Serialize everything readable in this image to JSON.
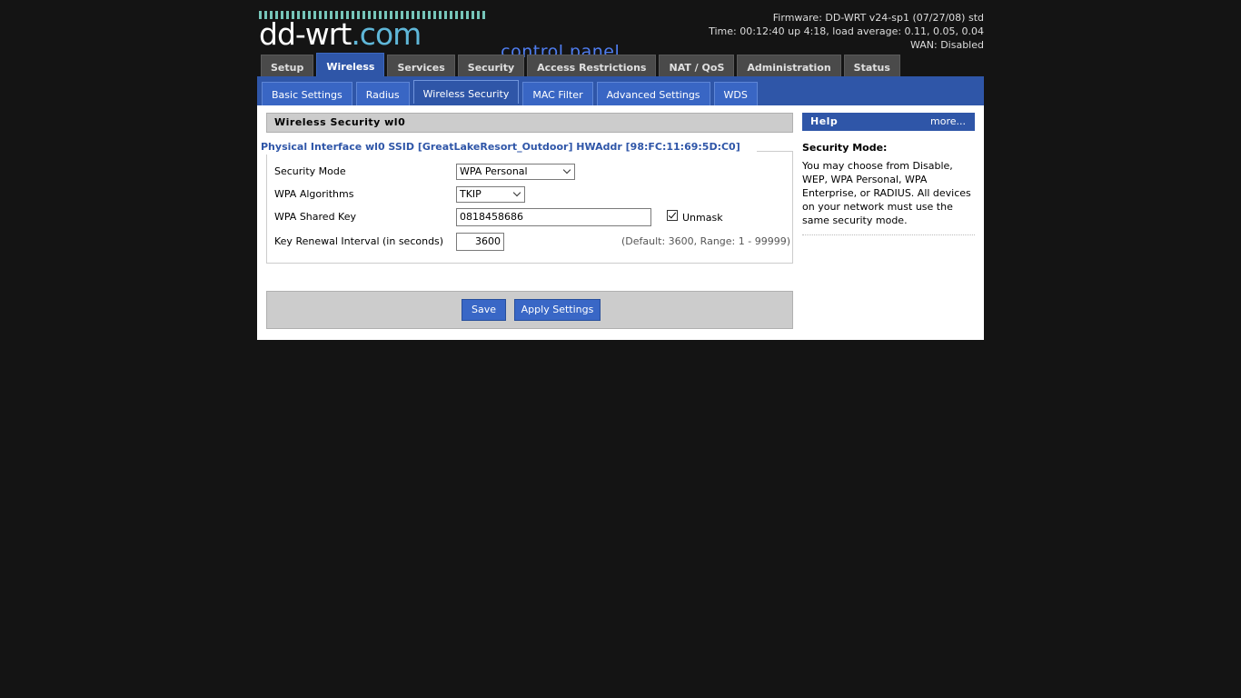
{
  "header": {
    "logo_main": "dd-wrt",
    "logo_com": ".com",
    "control_panel": "... control panel",
    "firmware": "Firmware: DD-WRT v24-sp1 (07/27/08) std",
    "time": "Time: 00:12:40 up 4:18, load average: 0.11, 0.05, 0.04",
    "wan": "WAN: Disabled"
  },
  "tabs": [
    {
      "label": "Setup"
    },
    {
      "label": "Wireless"
    },
    {
      "label": "Services"
    },
    {
      "label": "Security"
    },
    {
      "label": "Access Restrictions"
    },
    {
      "label": "NAT / QoS"
    },
    {
      "label": "Administration"
    },
    {
      "label": "Status"
    }
  ],
  "subtabs": [
    {
      "label": "Basic Settings"
    },
    {
      "label": "Radius"
    },
    {
      "label": "Wireless Security"
    },
    {
      "label": "MAC Filter"
    },
    {
      "label": "Advanced Settings"
    },
    {
      "label": "WDS"
    }
  ],
  "section": {
    "title": "Wireless Security wl0",
    "legend": "Physical Interface wl0 SSID [GreatLakeResort_Outdoor] HWAddr [98:FC:11:69:5D:C0]"
  },
  "form": {
    "security_mode_label": "Security Mode",
    "security_mode_value": "WPA Personal",
    "wpa_algorithms_label": "WPA Algorithms",
    "wpa_algorithms_value": "TKIP",
    "shared_key_label": "WPA Shared Key",
    "shared_key_value": "0818458686",
    "unmask_label": "Unmask",
    "renewal_label": "Key Renewal Interval (in seconds)",
    "renewal_value": "3600",
    "renewal_hint": "(Default: 3600, Range: 1 - 99999)"
  },
  "buttons": {
    "save": "Save",
    "apply": "Apply Settings"
  },
  "help": {
    "title": "Help",
    "more": "more...",
    "heading": "Security Mode:",
    "text": "You may choose from Disable, WEP, WPA Personal, WPA Enterprise, or RADIUS. All devices on your network must use the same security mode."
  },
  "colors": {
    "background": "#141414",
    "accent_blue": "#2f56a8",
    "panel_gray": "#cccccc",
    "logo_teal": "#76c5b9",
    "control_panel_blue": "#4f7df0"
  }
}
